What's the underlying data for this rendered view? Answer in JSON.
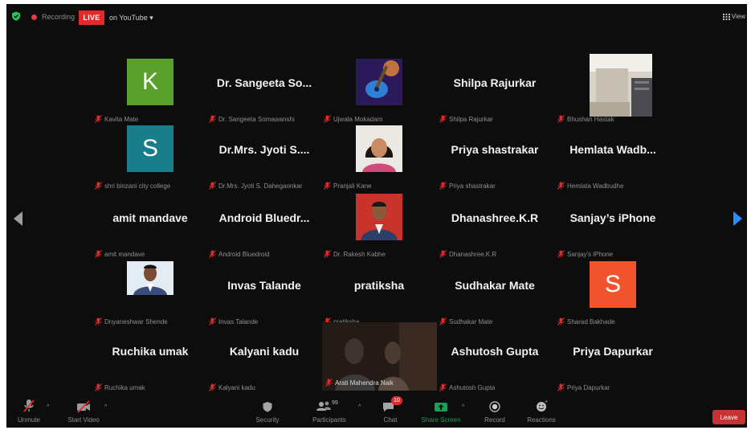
{
  "topbar": {
    "recording_label": "Recording",
    "live_label": "LIVE",
    "youtube_label": "on YouTube",
    "view_label": "View"
  },
  "colors": {
    "live_red": "#e02b2b",
    "next_arrow": "#2d8cff",
    "active_speaker": "#e5d25a",
    "leave_red": "#c73232"
  },
  "participants": [
    {
      "avatar_letter": "K",
      "avatar_color": "#5aa02c",
      "label": "Kavita Mate"
    },
    {
      "display_name": "Dr. Sangeeta So...",
      "label": "Dr. Sangeeta Somawanshi"
    },
    {
      "photo": "guitar-image",
      "label": "Ujwala Mokadam"
    },
    {
      "display_name": "Shilpa Rajurkar",
      "label": "Shilpa Rajurkar"
    },
    {
      "photo": "room-image",
      "label": "Bhushan Hastak"
    },
    {
      "avatar_letter": "S",
      "avatar_color": "#177e8a",
      "label": "shri binzani city college"
    },
    {
      "display_name": "Dr.Mrs. Jyoti S....",
      "label": "Dr.Mrs. Jyoti S. Dahegaonkar"
    },
    {
      "photo": "woman-portrait",
      "label": "Pranjali Kane"
    },
    {
      "display_name": "Priya shastrakar",
      "label": "Priya shastrakar"
    },
    {
      "display_name": "Hemlata Wadb...",
      "label": "Hemlata Wadbudhe"
    },
    {
      "display_name": "amit mandave",
      "label": "amit mandave"
    },
    {
      "display_name": "Android Bluedr...",
      "label": "Android Bluedroid"
    },
    {
      "photo": "man-portrait",
      "label": "Dr. Rakesh Kabhe"
    },
    {
      "display_name": "Dhanashree.K.R",
      "label": "Dhanashree.K.R"
    },
    {
      "display_name": "Sanjay’s iPhone",
      "label": "Sanjay's iPhone"
    },
    {
      "photo": "man-portrait-2",
      "label": "Dnyaneshwar Shende"
    },
    {
      "display_name": "Invas Talande",
      "label": "Invas Talande"
    },
    {
      "display_name": "pratiksha",
      "label": "pratiksha"
    },
    {
      "display_name": "Sudhakar Mate",
      "label": "Sudhakar Mate"
    },
    {
      "avatar_letter": "S",
      "avatar_color": "#f2542d",
      "label": "Sharad Bakhade"
    },
    {
      "display_name": "Ruchika umak",
      "label": "Ruchika umak"
    },
    {
      "display_name": "Kalyani kadu",
      "label": "Kalyani kadu"
    },
    {
      "video": "dark-video",
      "label": "Arati Mahendra Naik",
      "active": true
    },
    {
      "display_name": "Ashutosh Gupta",
      "label": "Ashutosh Gupta"
    },
    {
      "display_name": "Priya Dapurkar",
      "label": "Priya Dapurkar"
    }
  ],
  "toolbar": {
    "unmute": "Unmute",
    "start_video": "Start Video",
    "security": "Security",
    "participants": "Participants",
    "participants_count": "99",
    "chat": "Chat",
    "chat_badge": "10",
    "share_screen": "Share Screen",
    "record": "Record",
    "reactions": "Reactions",
    "leave": "Leave"
  }
}
